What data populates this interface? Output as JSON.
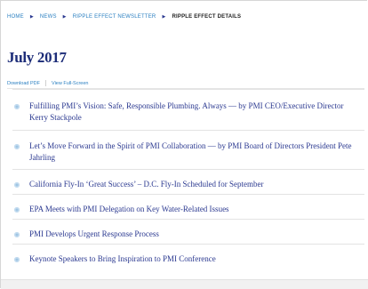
{
  "breadcrumb": {
    "items": [
      "HOME",
      "NEWS",
      "RIPPLE EFFECT NEWSLETTER"
    ],
    "current": "RIPPLE EFFECT DETAILS"
  },
  "page": {
    "title": "July 2017"
  },
  "links": {
    "download": "Download PDF",
    "fullscreen": "View Full-Screen"
  },
  "articles": [
    "Fulfilling PMI’s Vision: Safe, Responsible Plumbing. Always — by PMI CEO/Executive Director Kerry Stackpole",
    "Let’s Move Forward in the Spirit of PMI Collaboration — by PMI Board of Directors President Pete Jahrling",
    "California Fly-In ‘Great Success’ – D.C. Fly-In Scheduled for September",
    "EPA Meets with PMI Delegation on Key Water-Related Issues",
    "PMI Develops Urgent Response Process",
    "Keynote Speakers to Bring Inspiration to PMI Conference"
  ],
  "colors": {
    "accent": "#2b3990",
    "link": "#2a7fc1",
    "bullet": "#9fc5e3"
  }
}
